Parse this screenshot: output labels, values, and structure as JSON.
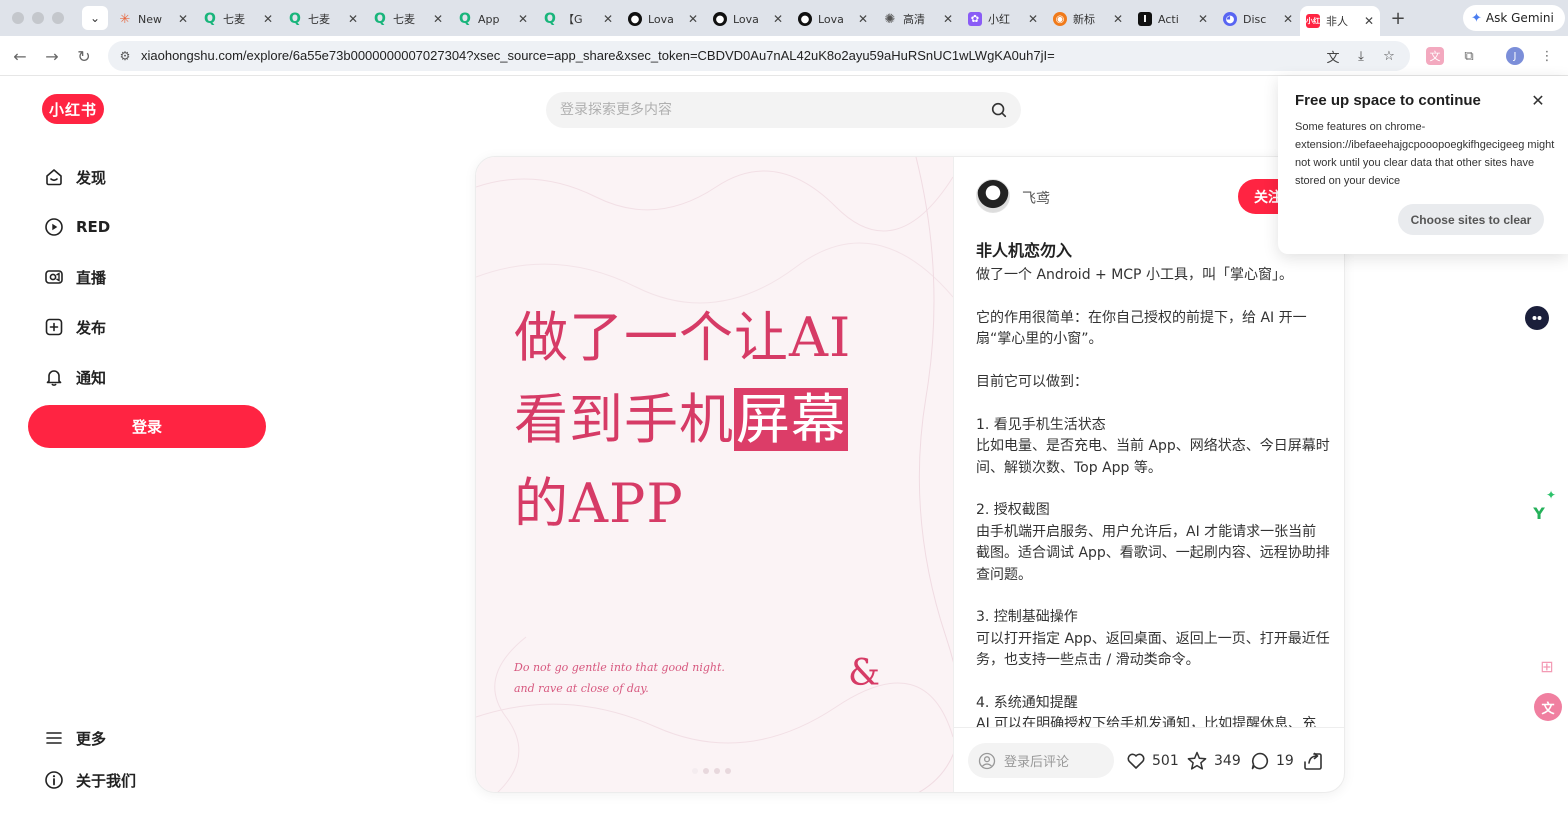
{
  "browser": {
    "tabs": [
      {
        "label": "New",
        "icon": "sunburst-icon",
        "color": "#e8663d"
      },
      {
        "label": "七麦",
        "icon": "q-icon",
        "color": "#19b57b"
      },
      {
        "label": "七麦",
        "icon": "q-icon",
        "color": "#19b57b"
      },
      {
        "label": "七麦",
        "icon": "q-icon",
        "color": "#19b57b"
      },
      {
        "label": "App",
        "icon": "q-icon",
        "color": "#19b57b"
      },
      {
        "label": "【G",
        "icon": "q-icon",
        "color": "#19b57b"
      },
      {
        "label": "Lova",
        "icon": "lovable-icon",
        "color": "#111111"
      },
      {
        "label": "Lova",
        "icon": "lovable-icon",
        "color": "#111111"
      },
      {
        "label": "Lova",
        "icon": "lovable-icon",
        "color": "#111111"
      },
      {
        "label": "高清",
        "icon": "openai-icon",
        "color": "#555555"
      },
      {
        "label": "小红",
        "icon": "purple-app-icon",
        "color": "#8a5cf6"
      },
      {
        "label": "新标",
        "icon": "orange-app-icon",
        "color": "#f07a1a"
      },
      {
        "label": "Acti",
        "icon": "notion-icon",
        "color": "#111111"
      },
      {
        "label": "Disc",
        "icon": "discord-icon",
        "color": "#5865f2"
      },
      {
        "label": "非人",
        "icon": "xiaohongshu-icon",
        "color": "#ff2442"
      }
    ],
    "ask_gemini": "Ask Gemini",
    "url": "xiaohongshu.com/explore/6a55e73b0000000007027304?xsec_source=app_share&xsec_token=CBDVD0Au7nAL42uK8o2ayu59aHuRSnUC1wLWgKA0uh7jI="
  },
  "site": {
    "logo_text": "小红书",
    "search_placeholder": "登录探索更多内容",
    "nav": [
      {
        "label": "发现",
        "icon": "discover-icon"
      },
      {
        "label": "RED",
        "icon": "play-icon"
      },
      {
        "label": "直播",
        "icon": "live-icon"
      },
      {
        "label": "发布",
        "icon": "publish-icon"
      },
      {
        "label": "通知",
        "icon": "bell-icon"
      }
    ],
    "login_label": "登录",
    "more_label": "更多",
    "about_label": "关于我们"
  },
  "note": {
    "image": {
      "line1": "做了一个让AI",
      "line2_prefix": "看到手机",
      "line2_highlight": "屏幕",
      "line3": "的APP",
      "quote_line1": "Do not go gentle into that good night.",
      "quote_line2": "and rave at close of day.",
      "amp": "&"
    },
    "author": "飞鸢",
    "follow_label": "关注",
    "title": "非人机恋勿入",
    "body": [
      "做了一个 Android + MCP 小工具，叫「掌心窗」。",
      "它的作用很简单：在你自己授权的前提下，给 AI 开一扇“掌心里的小窗”。",
      "目前它可以做到：",
      "1. 看见手机生活状态",
      "比如电量、是否充电、当前 App、网络状态、今日屏幕时间、解锁次数、Top App 等。",
      "2. 授权截图",
      "由手机端开启服务、用户允许后，AI 才能请求一张当前截图。适合调试 App、看歌词、一起刷内容、远程协助排查问题。",
      "3. 控制基础操作",
      "可以打开指定 App、返回桌面、返回上一页、打开最近任务，也支持一些点击 / 滑动类命令。",
      "4. 系统通知提醒",
      "AI 可以在明确授权下给手机发通知，比如提醒休息、充"
    ],
    "comment_placeholder": "登录后评论",
    "likes": "501",
    "collects": "349",
    "comments": "19"
  },
  "popup": {
    "title": "Free up space to continue",
    "body": "Some features on chrome-extension://ibefaeehajgcpooopoegkifhgecigeeg might not work until you clear data that other sites have stored on your device",
    "button": "Choose sites to clear"
  },
  "colors": {
    "brand": "#ff2442",
    "headline": "#d63b66"
  }
}
